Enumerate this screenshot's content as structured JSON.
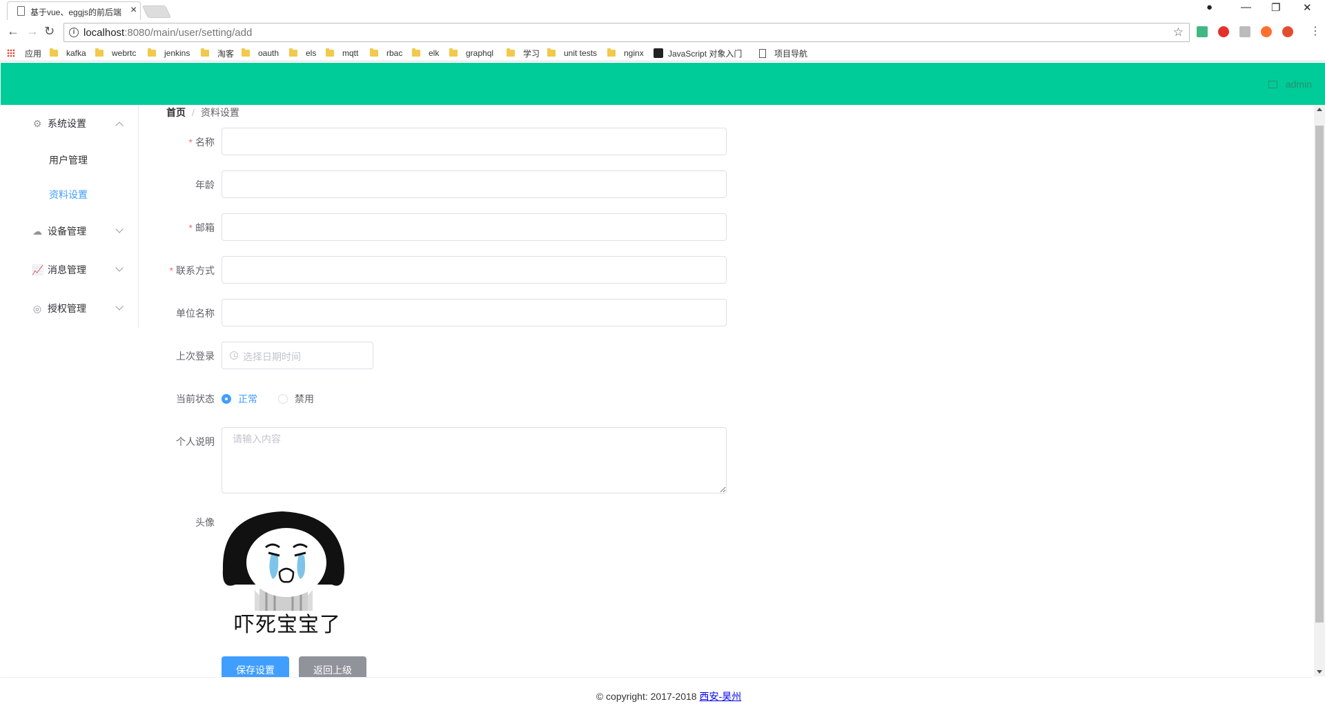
{
  "browser": {
    "tab_title": "基于vue、eggjs的前后端",
    "url_host": "localhost",
    "url_path": ":8080/main/user/setting/add",
    "bookmarks": [
      "应用",
      "kafka",
      "webrtc",
      "jenkins",
      "淘客",
      "oauth",
      "els",
      "mqtt",
      "rbac",
      "elk",
      "graphql",
      "学习",
      "unit tests",
      "nginx",
      "JavaScript 对象入门",
      "项目导航"
    ]
  },
  "header": {
    "username": "admin",
    "color": "#00cc99"
  },
  "sidebar": {
    "menus": [
      {
        "label": "系统设置",
        "icon": "gear-icon",
        "expanded": true,
        "children": [
          {
            "label": "用户管理",
            "active": false
          },
          {
            "label": "资料设置",
            "active": true
          }
        ]
      },
      {
        "label": "设备管理",
        "icon": "device-icon",
        "expanded": false
      },
      {
        "label": "消息管理",
        "icon": "chart-icon",
        "expanded": false
      },
      {
        "label": "授权管理",
        "icon": "globe-icon",
        "expanded": false
      }
    ]
  },
  "breadcrumb": {
    "home": "首页",
    "separator": "/",
    "current": "资料设置"
  },
  "form": {
    "name": {
      "label": "名称",
      "required": true,
      "value": ""
    },
    "age": {
      "label": "年龄",
      "required": false,
      "value": ""
    },
    "email": {
      "label": "邮箱",
      "required": true,
      "value": ""
    },
    "contact": {
      "label": "联系方式",
      "required": true,
      "value": ""
    },
    "company": {
      "label": "单位名称",
      "required": false,
      "value": ""
    },
    "last_login": {
      "label": "上次登录",
      "placeholder": "选择日期时间"
    },
    "status": {
      "label": "当前状态",
      "options": [
        "正常",
        "禁用"
      ],
      "selected": "正常"
    },
    "bio": {
      "label": "个人说明",
      "placeholder": "请输入内容"
    },
    "avatar": {
      "label": "头像",
      "caption": "吓死宝宝了"
    },
    "save_label": "保存设置",
    "back_label": "返回上级"
  },
  "footer": {
    "copyright": "© copyright: 2017-2018",
    "link_text": "西安-昊州"
  },
  "colors": {
    "primary": "#409eff",
    "info": "#909399",
    "required": "#f56c6c"
  }
}
